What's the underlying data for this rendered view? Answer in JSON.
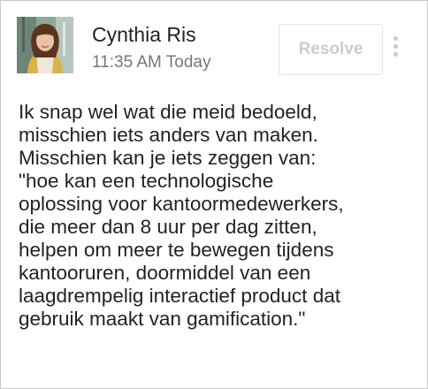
{
  "comment": {
    "author": "Cynthia Ris",
    "timestamp": "11:35 AM Today",
    "resolve_label": "Resolve",
    "avatar_icon": "user-photo",
    "more_icon": "vertical-ellipsis",
    "body": "Ik snap wel wat die meid bedoeld,\nmisschien iets anders van maken.\nMisschien kan je iets zeggen van:\n\"hoe kan een technologische\noplossing voor kantoormedewerkers,\ndie meer dan 8 uur per dag zitten,\nhelpen om meer te bewegen tijdens\nkantooruren, doormiddel van een\nlaagdrempelig interactief product dat\ngebruik maakt van gamification.\""
  }
}
